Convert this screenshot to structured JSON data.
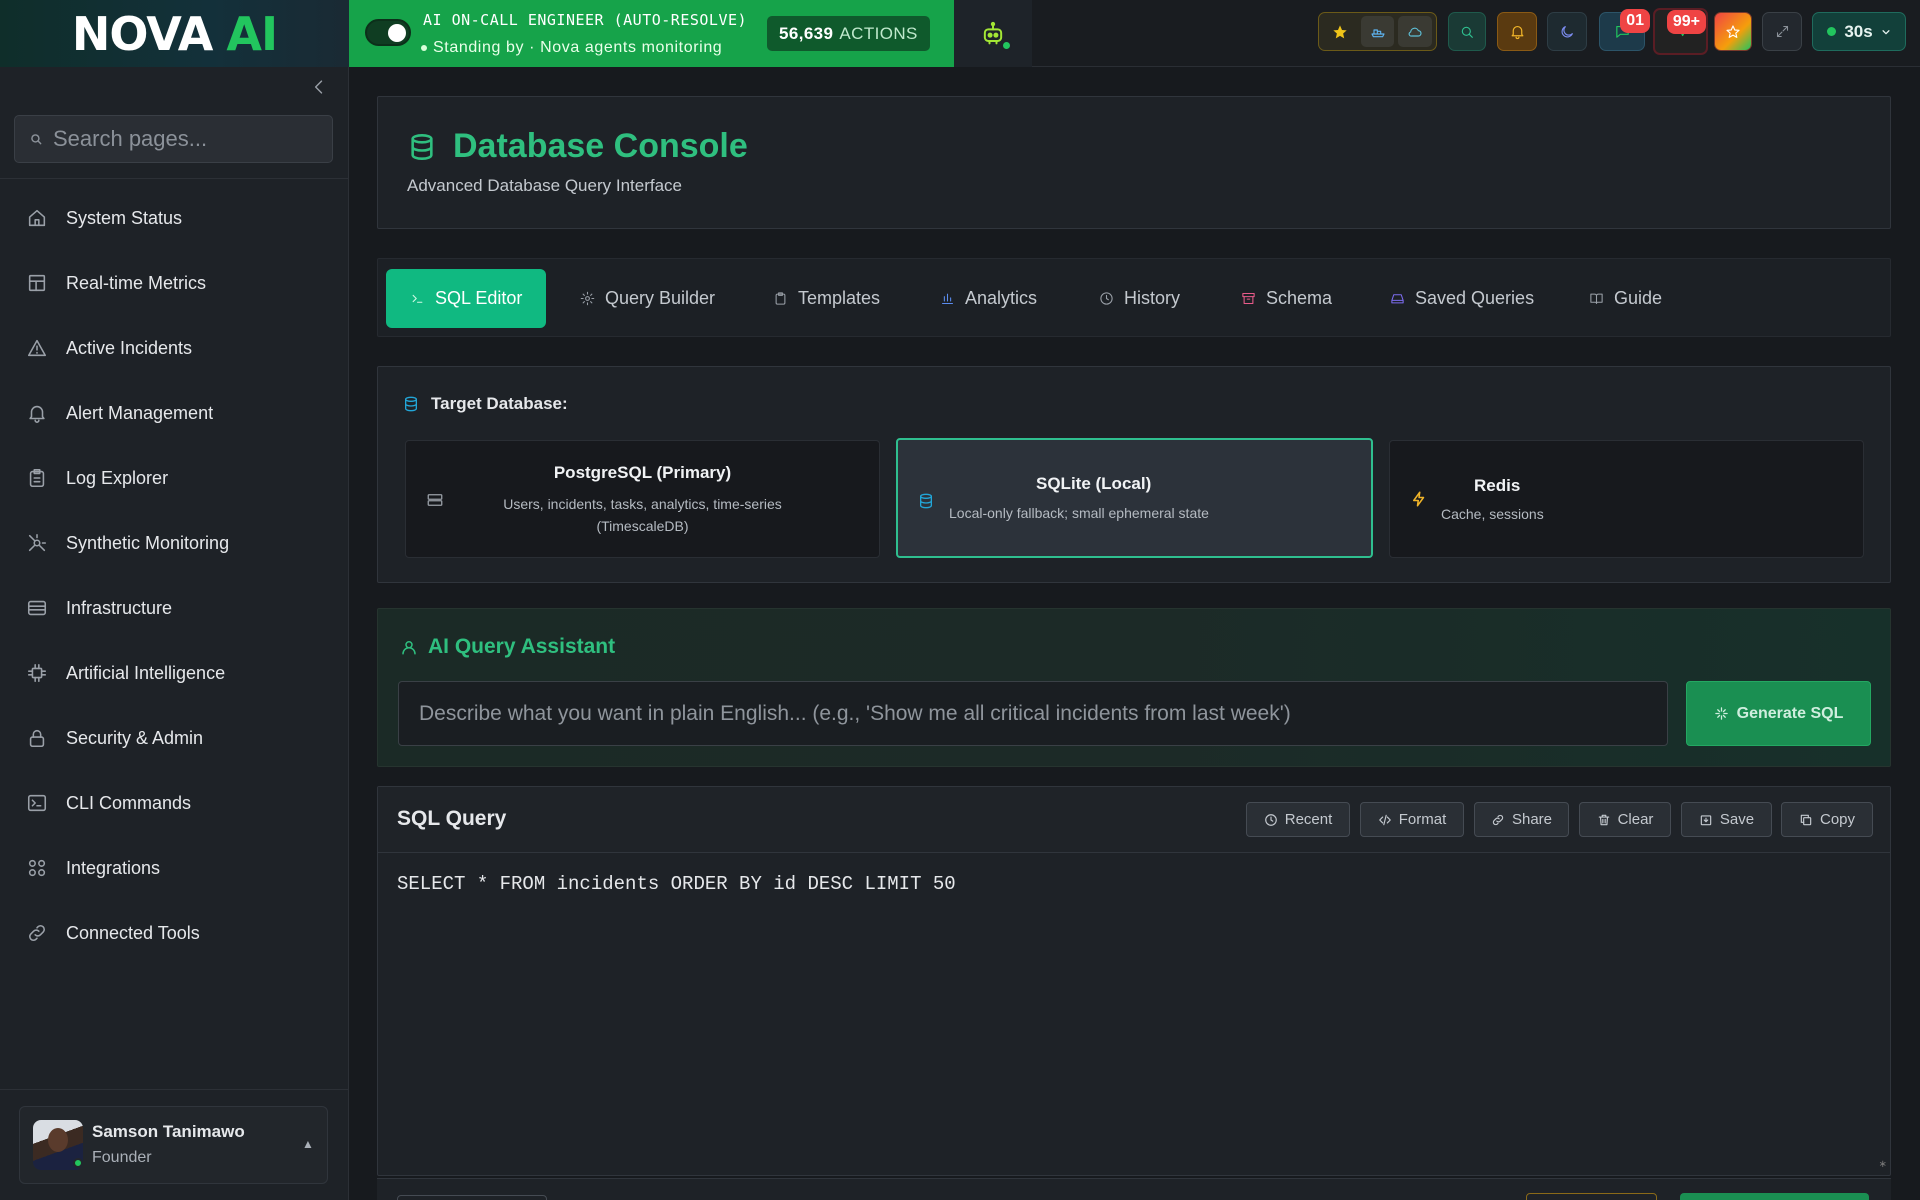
{
  "app": {
    "logo_main": "NOVA",
    "logo_ai": "AI"
  },
  "oncall": {
    "title": "AI ON-CALL ENGINEER (AUTO-RESOLVE)",
    "status": "Standing by · Nova agents monitoring",
    "actions_count": "56,639",
    "actions_label": "ACTIONS",
    "toggle_on": true
  },
  "topbar": {
    "icons": [
      "star-icon",
      "ship-icon",
      "cloud-icon",
      "search-icon",
      "bell-icon",
      "moon-icon",
      "chat-icon",
      "activity-icon",
      "favorite-icon",
      "expand-icon"
    ],
    "chat_badge": "01",
    "activity_badge": "99+",
    "refresh_interval": "30s"
  },
  "sidebar": {
    "search_placeholder": "Search pages...",
    "items": [
      {
        "label": "System Status",
        "icon": "home-icon"
      },
      {
        "label": "Real-time Metrics",
        "icon": "dashboard-icon"
      },
      {
        "label": "Active Incidents",
        "icon": "warning-icon"
      },
      {
        "label": "Alert Management",
        "icon": "bell-icon"
      },
      {
        "label": "Log Explorer",
        "icon": "clipboard-icon"
      },
      {
        "label": "Synthetic Monitoring",
        "icon": "radar-icon"
      },
      {
        "label": "Infrastructure",
        "icon": "server-icon"
      },
      {
        "label": "Artificial Intelligence",
        "icon": "chip-icon"
      },
      {
        "label": "Security & Admin",
        "icon": "lock-icon"
      },
      {
        "label": "CLI Commands",
        "icon": "terminal-icon"
      },
      {
        "label": "Integrations",
        "icon": "grid-icon"
      },
      {
        "label": "Connected Tools",
        "icon": "link-icon"
      }
    ],
    "user": {
      "name": "Samson Tanimawo",
      "role": "Founder"
    }
  },
  "page": {
    "title": "Database Console",
    "subtitle": "Advanced Database Query Interface"
  },
  "tabs": [
    {
      "label": "SQL Editor",
      "icon": "terminal-icon",
      "active": true
    },
    {
      "label": "Query Builder",
      "icon": "gear-icon"
    },
    {
      "label": "Templates",
      "icon": "clipboard-icon"
    },
    {
      "label": "Analytics",
      "icon": "bar-chart-icon"
    },
    {
      "label": "History",
      "icon": "clock-icon"
    },
    {
      "label": "Schema",
      "icon": "archive-icon"
    },
    {
      "label": "Saved Queries",
      "icon": "drive-icon"
    },
    {
      "label": "Guide",
      "icon": "book-icon"
    }
  ],
  "target": {
    "label": "Target Database:",
    "databases": [
      {
        "name": "PostgreSQL (Primary)",
        "desc_line1": "Users, incidents, tasks, analytics, time-series",
        "desc_line2": "(TimescaleDB)",
        "icon": "server-icon",
        "icon_color": "#9aa0a8",
        "selected": false
      },
      {
        "name": "SQLite (Local)",
        "desc_line1": "Local-only fallback; small ephemeral state",
        "desc_line2": "",
        "icon": "database-icon",
        "icon_color": "#22a6d8",
        "selected": true
      },
      {
        "name": "Redis",
        "desc_line1": "Cache, sessions",
        "desc_line2": "",
        "icon": "bolt-icon",
        "icon_color": "#f0b429",
        "selected": false
      }
    ]
  },
  "ai_assistant": {
    "title": "AI Query Assistant",
    "placeholder": "Describe what you want in plain English... (e.g., 'Show me all critical incidents from last week')",
    "generate_label": "Generate SQL"
  },
  "sql": {
    "title": "SQL Query",
    "buttons": [
      "Recent",
      "Format",
      "Share",
      "Clear",
      "Save",
      "Copy"
    ],
    "query": "SELECT * FROM incidents ORDER BY id DESC LIMIT 50"
  },
  "colors": {
    "accent": "#10b981",
    "brand_green": "#16a34a",
    "badge_red": "#ef4444"
  }
}
